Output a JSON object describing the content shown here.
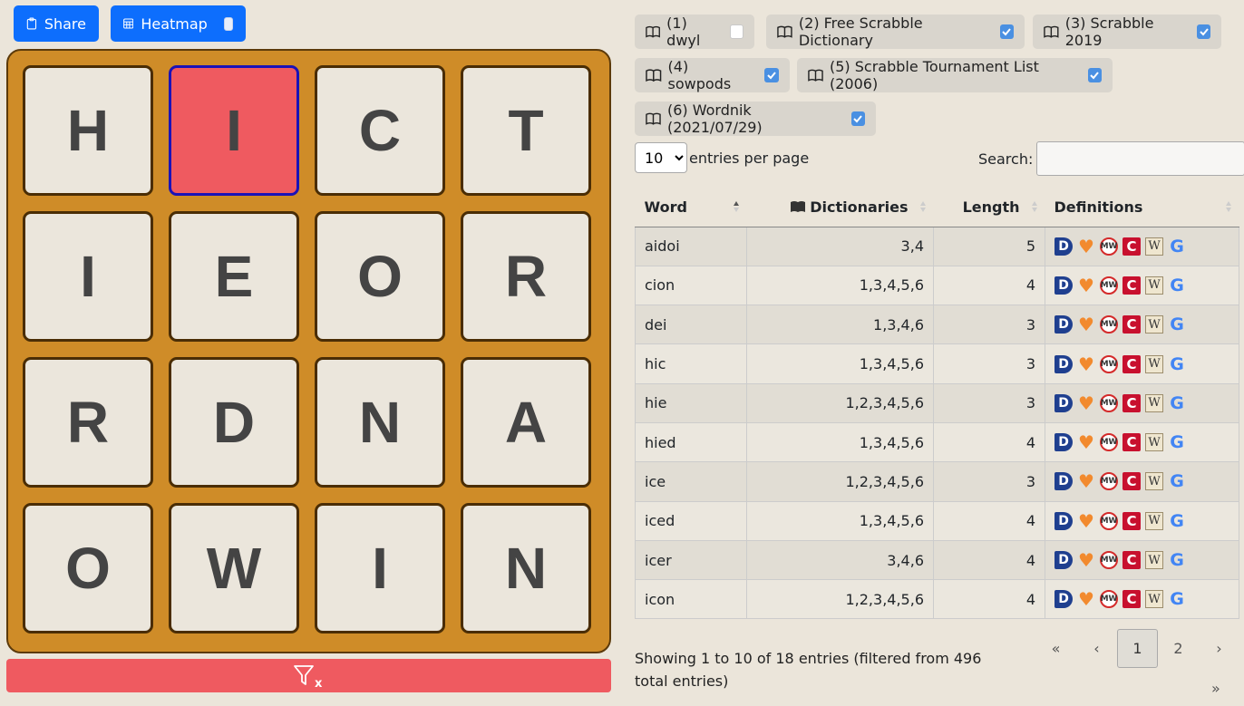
{
  "toolbar": {
    "share_label": "Share",
    "heatmap_label": "Heatmap"
  },
  "board": {
    "tiles": [
      "H",
      "I",
      "C",
      "T",
      "I",
      "E",
      "O",
      "R",
      "R",
      "D",
      "N",
      "A",
      "O",
      "W",
      "I",
      "N"
    ],
    "selected_index": 1
  },
  "filter_bar": {
    "icon": "filter-clear-icon",
    "label": "x"
  },
  "dictionaries": [
    {
      "label": "(1) dwyl",
      "checked": false
    },
    {
      "label": "(2) Free Scrabble Dictionary",
      "checked": true
    },
    {
      "label": "(3) Scrabble 2019",
      "checked": true
    },
    {
      "label": "(4) sowpods",
      "checked": true
    },
    {
      "label": "(5) Scrabble Tournament List (2006)",
      "checked": true
    },
    {
      "label": "(6) Wordnik (2021/07/29)",
      "checked": true
    }
  ],
  "table_controls": {
    "per_page_value": "10",
    "per_page_label": "entries per page",
    "search_label": "Search:"
  },
  "columns": {
    "word": "Word",
    "dictionaries": "Dictionaries",
    "length": "Length",
    "definitions": "Definitions"
  },
  "rows": [
    {
      "word": "aidoi",
      "dicts": "3,4",
      "length": "5"
    },
    {
      "word": "cion",
      "dicts": "1,3,4,5,6",
      "length": "4"
    },
    {
      "word": "dei",
      "dicts": "1,3,4,6",
      "length": "3"
    },
    {
      "word": "hic",
      "dicts": "1,3,4,5,6",
      "length": "3"
    },
    {
      "word": "hie",
      "dicts": "1,2,3,4,5,6",
      "length": "3"
    },
    {
      "word": "hied",
      "dicts": "1,3,4,5,6",
      "length": "4"
    },
    {
      "word": "ice",
      "dicts": "1,2,3,4,5,6",
      "length": "3"
    },
    {
      "word": "iced",
      "dicts": "1,3,4,5,6",
      "length": "4"
    },
    {
      "word": "icer",
      "dicts": "3,4,6",
      "length": "4"
    },
    {
      "word": "icon",
      "dicts": "1,2,3,4,5,6",
      "length": "4"
    }
  ],
  "definition_icons": [
    "dictionary-com-icon",
    "heart-icon",
    "merriam-webster-icon",
    "collins-icon",
    "wiktionary-icon",
    "google-icon"
  ],
  "info": "Showing 1 to 10 of 18 entries (filtered from 496 total entries)",
  "pager": {
    "first": "«",
    "prev": "‹",
    "pages": [
      "1",
      "2"
    ],
    "next": "›",
    "last": "»",
    "current": "1"
  },
  "colors": {
    "accent": "#0d6efd",
    "board": "#cf8c28",
    "selected_tile": "#ef5a60",
    "filter_bar": "#ef5a60",
    "check_on": "#4a90e2"
  }
}
